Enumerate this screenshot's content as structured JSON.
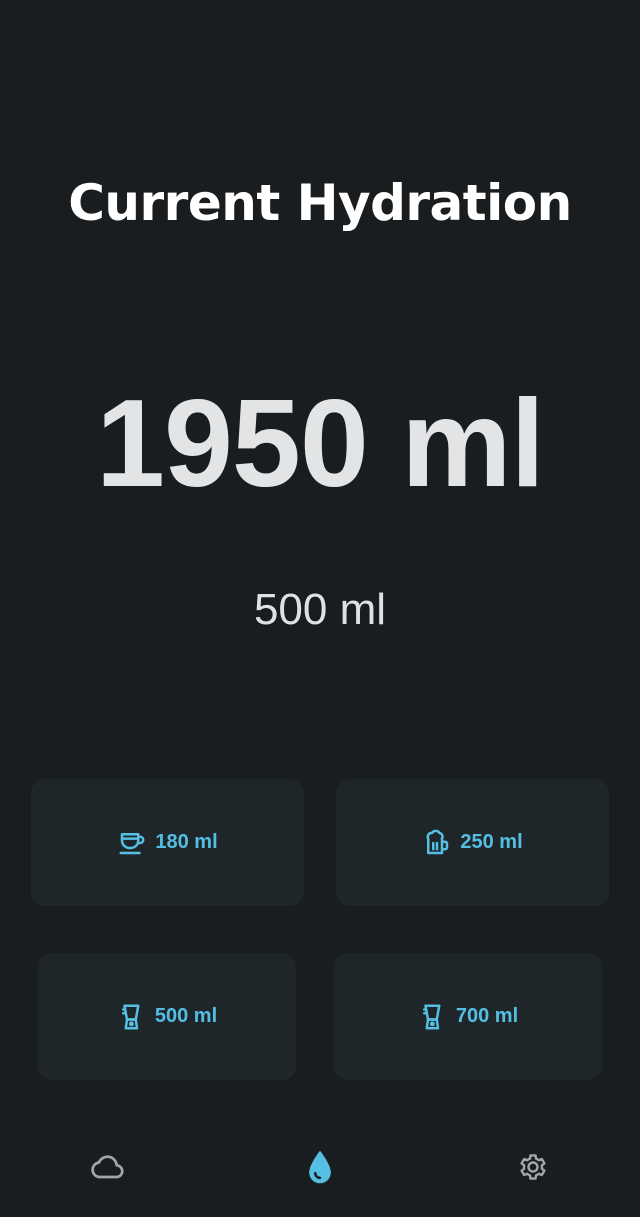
{
  "screen": {
    "title": "Current Hydration",
    "total": "1950 ml",
    "selected_amount": "500 ml"
  },
  "quick_add": [
    {
      "label": "180 ml",
      "icon": "coffee-cup-icon"
    },
    {
      "label": "250 ml",
      "icon": "beer-mug-icon"
    },
    {
      "label": "500 ml",
      "icon": "blender-icon"
    },
    {
      "label": "700 ml",
      "icon": "blender-icon"
    }
  ],
  "bottom_nav": [
    {
      "id": "weather",
      "icon": "cloud-icon",
      "active": false
    },
    {
      "id": "hydration",
      "icon": "water-drop-icon",
      "active": true
    },
    {
      "id": "settings",
      "icon": "gear-icon",
      "active": false
    }
  ],
  "colors": {
    "background": "#1a1d1f",
    "card": "#1f262a",
    "accent": "#55bfe3",
    "title": "#ffffff",
    "total": "#e3e4e5",
    "nav_inactive": "#a3a6a8"
  }
}
